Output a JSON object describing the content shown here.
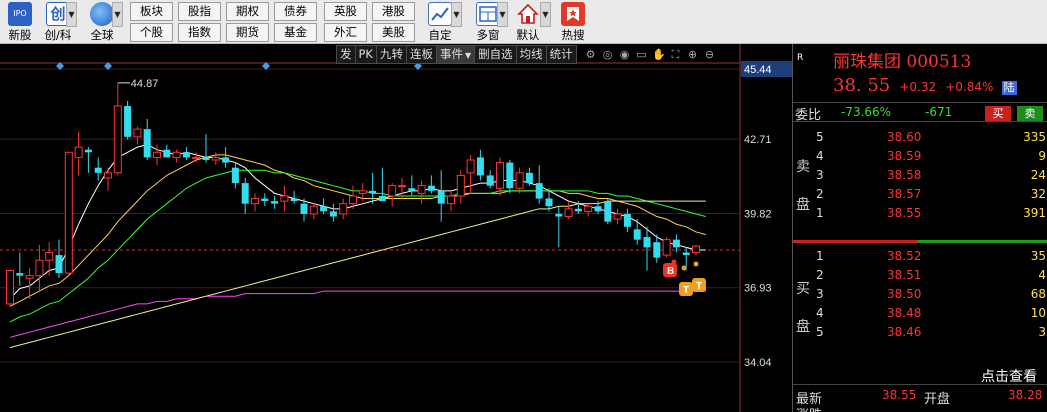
{
  "toolbar": {
    "big_buttons": [
      {
        "label": "新股",
        "icon": "ipo-icon"
      },
      {
        "label": "创/科",
        "icon": "chuang-icon"
      },
      {
        "label": "全球",
        "icon": "globe-icon"
      },
      {
        "label": "自定",
        "icon": "custom-icon"
      },
      {
        "label": "多窗",
        "icon": "multi-window-icon"
      },
      {
        "label": "默认",
        "icon": "home-icon"
      },
      {
        "label": "热搜",
        "icon": "hot-search-icon"
      }
    ],
    "grid_row1": [
      "板块",
      "股指",
      "期权",
      "债券",
      "英股",
      "港股"
    ],
    "grid_row2": [
      "个股",
      "指数",
      "期货",
      "基金",
      "外汇",
      "美股"
    ]
  },
  "chart": {
    "toolbar": [
      "发",
      "PK",
      "九转",
      "连板",
      "事件",
      "删自选",
      "均线",
      "统计"
    ],
    "icons": [
      "settings-icon",
      "target-icon",
      "eye-icon",
      "message-icon",
      "hand-icon",
      "expand-icon",
      "zoom-in-icon",
      "zoom-out-icon"
    ],
    "max_label": "44.87",
    "markers": [
      "B",
      "T",
      "T"
    ]
  },
  "chart_data": {
    "type": "candlestick",
    "y_ticks": [
      "45.44",
      "42.71",
      "39.82",
      "36.93",
      "34.04"
    ],
    "ylim": [
      34.04,
      45.44
    ],
    "current_price_line": 38.4,
    "max_high": 44.87,
    "candles": [
      {
        "o": 36.3,
        "h": 37.6,
        "l": 36.2,
        "c": 37.6,
        "up": true
      },
      {
        "o": 37.5,
        "h": 38.3,
        "l": 37.0,
        "c": 37.4,
        "up": false
      },
      {
        "o": 37.3,
        "h": 37.7,
        "l": 36.5,
        "c": 37.4,
        "up": true
      },
      {
        "o": 37.4,
        "h": 38.6,
        "l": 36.8,
        "c": 38.0,
        "up": true
      },
      {
        "o": 38.0,
        "h": 38.7,
        "l": 37.4,
        "c": 38.3,
        "up": true
      },
      {
        "o": 38.2,
        "h": 38.8,
        "l": 37.3,
        "c": 37.5,
        "up": false
      },
      {
        "o": 37.5,
        "h": 42.2,
        "l": 37.4,
        "c": 42.2,
        "up": true
      },
      {
        "o": 42.0,
        "h": 43.0,
        "l": 41.3,
        "c": 42.4,
        "up": true
      },
      {
        "o": 42.3,
        "h": 42.4,
        "l": 41.4,
        "c": 42.2,
        "up": false
      },
      {
        "o": 41.6,
        "h": 42.0,
        "l": 41.1,
        "c": 41.4,
        "up": false
      },
      {
        "o": 41.2,
        "h": 41.6,
        "l": 40.7,
        "c": 41.4,
        "up": true
      },
      {
        "o": 41.4,
        "h": 44.9,
        "l": 41.3,
        "c": 44.0,
        "up": true
      },
      {
        "o": 44.0,
        "h": 44.2,
        "l": 42.7,
        "c": 42.8,
        "up": false
      },
      {
        "o": 42.8,
        "h": 43.2,
        "l": 42.5,
        "c": 43.1,
        "up": true
      },
      {
        "o": 43.1,
        "h": 43.5,
        "l": 41.9,
        "c": 42.0,
        "up": false
      },
      {
        "o": 42.0,
        "h": 42.5,
        "l": 41.7,
        "c": 42.2,
        "up": true
      },
      {
        "o": 42.3,
        "h": 42.5,
        "l": 42.0,
        "c": 42.0,
        "up": false
      },
      {
        "o": 42.0,
        "h": 42.3,
        "l": 41.8,
        "c": 42.2,
        "up": true
      },
      {
        "o": 42.2,
        "h": 42.4,
        "l": 41.9,
        "c": 42.0,
        "up": false
      },
      {
        "o": 42.0,
        "h": 42.2,
        "l": 41.8,
        "c": 42.0,
        "up": true
      },
      {
        "o": 42.0,
        "h": 42.9,
        "l": 41.8,
        "c": 41.9,
        "up": false
      },
      {
        "o": 41.9,
        "h": 42.2,
        "l": 41.7,
        "c": 42.0,
        "up": true
      },
      {
        "o": 42.0,
        "h": 42.4,
        "l": 41.6,
        "c": 41.8,
        "up": false
      },
      {
        "o": 41.6,
        "h": 41.8,
        "l": 40.8,
        "c": 41.0,
        "up": false
      },
      {
        "o": 41.0,
        "h": 41.2,
        "l": 39.8,
        "c": 40.2,
        "up": false
      },
      {
        "o": 40.2,
        "h": 40.6,
        "l": 39.9,
        "c": 40.4,
        "up": true
      },
      {
        "o": 40.4,
        "h": 40.6,
        "l": 40.1,
        "c": 40.3,
        "up": false
      },
      {
        "o": 40.3,
        "h": 40.5,
        "l": 40.0,
        "c": 40.2,
        "up": false
      },
      {
        "o": 40.3,
        "h": 40.9,
        "l": 39.9,
        "c": 40.5,
        "up": true
      },
      {
        "o": 40.4,
        "h": 40.7,
        "l": 40.2,
        "c": 40.3,
        "up": false
      },
      {
        "o": 40.2,
        "h": 40.4,
        "l": 39.5,
        "c": 39.8,
        "up": false
      },
      {
        "o": 39.8,
        "h": 40.2,
        "l": 39.6,
        "c": 40.1,
        "up": true
      },
      {
        "o": 40.1,
        "h": 40.4,
        "l": 39.8,
        "c": 39.9,
        "up": false
      },
      {
        "o": 39.9,
        "h": 40.2,
        "l": 39.5,
        "c": 39.7,
        "up": false
      },
      {
        "o": 39.8,
        "h": 40.4,
        "l": 39.6,
        "c": 40.2,
        "up": true
      },
      {
        "o": 40.2,
        "h": 40.9,
        "l": 40.0,
        "c": 40.5,
        "up": true
      },
      {
        "o": 40.6,
        "h": 41.0,
        "l": 40.3,
        "c": 40.7,
        "up": true
      },
      {
        "o": 40.7,
        "h": 41.4,
        "l": 40.2,
        "c": 40.6,
        "up": false
      },
      {
        "o": 40.5,
        "h": 41.6,
        "l": 40.3,
        "c": 40.3,
        "up": false
      },
      {
        "o": 40.5,
        "h": 41.0,
        "l": 40.1,
        "c": 40.9,
        "up": true
      },
      {
        "o": 40.9,
        "h": 41.2,
        "l": 40.4,
        "c": 40.9,
        "up": true
      },
      {
        "o": 40.8,
        "h": 41.3,
        "l": 40.5,
        "c": 40.7,
        "up": false
      },
      {
        "o": 40.6,
        "h": 41.1,
        "l": 40.2,
        "c": 40.9,
        "up": true
      },
      {
        "o": 40.9,
        "h": 41.3,
        "l": 40.6,
        "c": 40.7,
        "up": false
      },
      {
        "o": 40.7,
        "h": 41.5,
        "l": 39.5,
        "c": 40.2,
        "up": false
      },
      {
        "o": 40.2,
        "h": 40.7,
        "l": 39.9,
        "c": 40.5,
        "up": true
      },
      {
        "o": 40.5,
        "h": 41.5,
        "l": 40.2,
        "c": 41.3,
        "up": true
      },
      {
        "o": 41.4,
        "h": 42.1,
        "l": 40.6,
        "c": 41.9,
        "up": true
      },
      {
        "o": 42.0,
        "h": 42.3,
        "l": 41.1,
        "c": 41.3,
        "up": false
      },
      {
        "o": 41.3,
        "h": 41.5,
        "l": 40.8,
        "c": 40.9,
        "up": false
      },
      {
        "o": 40.8,
        "h": 42.0,
        "l": 40.5,
        "c": 41.8,
        "up": true
      },
      {
        "o": 41.8,
        "h": 41.9,
        "l": 40.6,
        "c": 40.8,
        "up": false
      },
      {
        "o": 40.8,
        "h": 41.6,
        "l": 40.6,
        "c": 41.4,
        "up": true
      },
      {
        "o": 41.4,
        "h": 41.6,
        "l": 40.9,
        "c": 41.0,
        "up": false
      },
      {
        "o": 41.0,
        "h": 41.7,
        "l": 40.2,
        "c": 40.4,
        "up": false
      },
      {
        "o": 40.4,
        "h": 40.8,
        "l": 39.9,
        "c": 40.1,
        "up": false
      },
      {
        "o": 39.8,
        "h": 40.1,
        "l": 38.5,
        "c": 39.7,
        "up": false
      },
      {
        "o": 39.7,
        "h": 40.3,
        "l": 39.6,
        "c": 40.0,
        "up": true
      },
      {
        "o": 40.0,
        "h": 40.3,
        "l": 39.8,
        "c": 39.9,
        "up": false
      },
      {
        "o": 39.9,
        "h": 40.2,
        "l": 39.7,
        "c": 40.1,
        "up": true
      },
      {
        "o": 40.1,
        "h": 40.3,
        "l": 39.8,
        "c": 39.9,
        "up": false
      },
      {
        "o": 40.3,
        "h": 40.4,
        "l": 39.4,
        "c": 39.5,
        "up": false
      },
      {
        "o": 39.6,
        "h": 40.0,
        "l": 39.4,
        "c": 39.8,
        "up": true
      },
      {
        "o": 39.8,
        "h": 40.0,
        "l": 39.1,
        "c": 39.3,
        "up": false
      },
      {
        "o": 39.2,
        "h": 39.6,
        "l": 38.6,
        "c": 38.8,
        "up": false
      },
      {
        "o": 38.9,
        "h": 39.3,
        "l": 37.6,
        "c": 38.5,
        "up": false
      },
      {
        "o": 38.7,
        "h": 39.0,
        "l": 37.9,
        "c": 38.1,
        "up": false
      },
      {
        "o": 38.2,
        "h": 38.9,
        "l": 38.1,
        "c": 38.8,
        "up": true
      },
      {
        "o": 38.8,
        "h": 39.0,
        "l": 38.3,
        "c": 38.5,
        "up": false
      },
      {
        "o": 38.3,
        "h": 38.5,
        "l": 37.6,
        "c": 38.2,
        "up": false
      },
      {
        "o": 38.3,
        "h": 38.6,
        "l": 38.2,
        "c": 38.55,
        "up": true
      }
    ],
    "ma_lines": [
      {
        "color": "#ffffff",
        "values": [
          36.5,
          36.9,
          37.0,
          37.3,
          37.6,
          37.7,
          38.5,
          39.4,
          40.2,
          40.9,
          41.5,
          42.0,
          42.2,
          42.4,
          42.5,
          42.3,
          42.2,
          42.1,
          42.2,
          42.1,
          42.0,
          42.0,
          41.9,
          41.8,
          41.6,
          41.2,
          40.9,
          40.6,
          40.5,
          40.4,
          40.3,
          40.2,
          40.1,
          40.0,
          40.0,
          40.1,
          40.2,
          40.3,
          40.4,
          40.5,
          40.6,
          40.7,
          40.7,
          40.8,
          40.7,
          40.7,
          40.8,
          40.9,
          41.0,
          41.0,
          41.1,
          41.1,
          41.1,
          41.0,
          40.9,
          40.7,
          40.5,
          40.3,
          40.2,
          40.1,
          40.0,
          39.9,
          39.8,
          39.7,
          39.5,
          39.2,
          38.9,
          38.7,
          38.6,
          38.5,
          38.4,
          38.4
        ]
      },
      {
        "color": "#ffd24a",
        "values": [
          36.2,
          36.4,
          36.6,
          36.8,
          37.0,
          37.1,
          37.4,
          37.8,
          38.2,
          38.6,
          39.0,
          39.5,
          39.9,
          40.3,
          40.7,
          41.0,
          41.3,
          41.5,
          41.7,
          41.9,
          42.0,
          42.1,
          42.1,
          42.0,
          41.9,
          41.8,
          41.7,
          41.5,
          41.4,
          41.2,
          41.1,
          40.9,
          40.8,
          40.7,
          40.6,
          40.5,
          40.4,
          40.4,
          40.4,
          40.4,
          40.4,
          40.4,
          40.4,
          40.4,
          40.5,
          40.5,
          40.5,
          40.6,
          40.6,
          40.6,
          40.6,
          40.7,
          40.7,
          40.7,
          40.7,
          40.7,
          40.7,
          40.6,
          40.6,
          40.5,
          40.4,
          40.4,
          40.3,
          40.2,
          40.1,
          39.9,
          39.7,
          39.6,
          39.4,
          39.3,
          39.1,
          39.0
        ]
      },
      {
        "color": "#33ff33",
        "values": [
          35.6,
          35.8,
          35.9,
          36.1,
          36.3,
          36.4,
          36.7,
          37.0,
          37.3,
          37.7,
          38.0,
          38.4,
          38.8,
          39.2,
          39.6,
          39.9,
          40.2,
          40.5,
          40.8,
          41.0,
          41.2,
          41.3,
          41.4,
          41.5,
          41.5,
          41.5,
          41.5,
          41.4,
          41.4,
          41.3,
          41.2,
          41.1,
          41.0,
          40.9,
          40.8,
          40.7,
          40.7,
          40.6,
          40.6,
          40.5,
          40.5,
          40.5,
          40.5,
          40.5,
          40.5,
          40.5,
          40.6,
          40.6,
          40.6,
          40.6,
          40.7,
          40.7,
          40.7,
          40.7,
          40.7,
          40.7,
          40.7,
          40.7,
          40.7,
          40.7,
          40.6,
          40.6,
          40.5,
          40.5,
          40.4,
          40.3,
          40.2,
          40.1,
          40.0,
          39.9,
          39.8,
          39.7
        ]
      },
      {
        "color": "#ff44ff",
        "values": [
          35.0,
          35.1,
          35.2,
          35.3,
          35.4,
          35.5,
          35.6,
          35.7,
          35.8,
          35.9,
          36.0,
          36.1,
          36.2,
          36.3,
          36.3,
          36.4,
          36.4,
          36.5,
          36.5,
          36.5,
          36.6,
          36.6,
          36.6,
          36.6,
          36.7,
          36.7,
          36.7,
          36.7,
          36.7,
          36.7,
          36.7,
          36.7,
          36.8,
          36.8,
          36.8,
          36.8,
          36.8,
          36.8,
          36.8,
          36.8,
          36.8,
          36.8,
          36.8,
          36.8,
          36.8,
          36.8,
          36.8,
          36.8,
          36.8,
          36.8,
          36.8,
          36.8,
          36.8,
          36.8,
          36.8,
          36.8,
          36.8,
          36.8,
          36.8,
          36.8,
          36.8,
          36.8,
          36.8,
          36.8,
          36.8,
          36.8,
          36.8,
          36.8,
          36.8,
          36.8,
          36.8,
          36.8
        ]
      },
      {
        "color": "#f0f08a",
        "values": [
          34.6,
          34.7,
          34.8,
          34.9,
          35.0,
          35.1,
          35.2,
          35.3,
          35.4,
          35.5,
          35.6,
          35.7,
          35.8,
          35.9,
          36.0,
          36.1,
          36.2,
          36.3,
          36.4,
          36.5,
          36.6,
          36.7,
          36.8,
          36.9,
          37.0,
          37.1,
          37.2,
          37.3,
          37.4,
          37.5,
          37.6,
          37.7,
          37.8,
          37.9,
          38.0,
          38.1,
          38.2,
          38.3,
          38.4,
          38.5,
          38.6,
          38.7,
          38.8,
          38.9,
          39.0,
          39.1,
          39.2,
          39.3,
          39.4,
          39.5,
          39.6,
          39.7,
          39.8,
          39.9,
          40.0,
          40.0,
          40.1,
          40.1,
          40.2,
          40.2,
          40.2,
          40.3,
          40.3,
          40.3,
          40.3,
          40.3,
          40.3,
          40.3,
          40.3,
          40.3,
          40.3,
          40.3
        ]
      }
    ]
  },
  "quote": {
    "name_code": "丽珠集团 000513",
    "price": "38. 55",
    "change": "+0.32",
    "pct": "+0.84%",
    "badge": "陆",
    "r_label": "R"
  },
  "weibi": {
    "label": "委比",
    "ratio": "-73.66%",
    "diff": "-671",
    "buy_label": "买",
    "sell_label": "卖"
  },
  "order_book": {
    "sell_side_label": [
      "卖",
      "盘"
    ],
    "buy_side_label": [
      "买",
      "盘"
    ],
    "asks": [
      {
        "level": "5",
        "price": "38.60",
        "vol": "335"
      },
      {
        "level": "4",
        "price": "38.59",
        "vol": "9"
      },
      {
        "level": "3",
        "price": "38.58",
        "vol": "24"
      },
      {
        "level": "2",
        "price": "38.57",
        "vol": "32"
      },
      {
        "level": "1",
        "price": "38.55",
        "vol": "391"
      }
    ],
    "bids": [
      {
        "level": "1",
        "price": "38.52",
        "vol": "35"
      },
      {
        "level": "2",
        "price": "38.51",
        "vol": "4"
      },
      {
        "level": "3",
        "price": "38.50",
        "vol": "68"
      },
      {
        "level": "4",
        "price": "38.48",
        "vol": "10"
      },
      {
        "level": "5",
        "price": "38.46",
        "vol": "3"
      }
    ]
  },
  "bottom": {
    "click_view": "点击查看",
    "latest_label": "最新",
    "latest_value": "38.55",
    "open_label": "开盘",
    "open_value": "38.28",
    "change_label": "涨跌"
  }
}
